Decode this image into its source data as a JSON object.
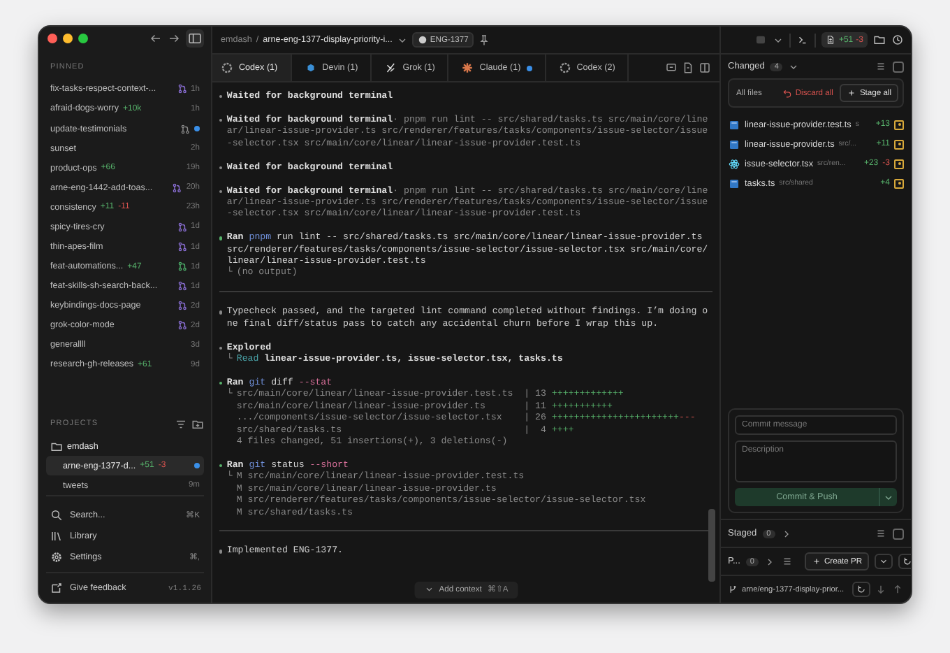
{
  "sidebar": {
    "pinned_label": "PINNED",
    "pinned": [
      {
        "name": "fix-tasks-respect-context-...",
        "pr": {
          "color": "#8b6fd6"
        },
        "time": "1h",
        "unread": false
      },
      {
        "name": "afraid-dogs-worry",
        "additions": "+10k",
        "time": "1h",
        "unread": false
      },
      {
        "name": "update-testimonials",
        "pr": {
          "color": "#8a8a8a"
        },
        "unread": true
      },
      {
        "name": "sunset",
        "time": "2h",
        "unread": false
      },
      {
        "name": "product-ops",
        "additions": "+66",
        "time": "19h",
        "unread": false
      },
      {
        "name": "arne-eng-1442-add-toas...",
        "pr": {
          "color": "#8b6fd6"
        },
        "time": "20h",
        "unread": false
      },
      {
        "name": "consistency",
        "additions": "+11",
        "deletions": "-11",
        "time": "23h",
        "unread": false
      },
      {
        "name": "spicy-tires-cry",
        "pr": {
          "color": "#8b6fd6"
        },
        "time": "1d",
        "unread": false
      },
      {
        "name": "thin-apes-film",
        "pr": {
          "color": "#8b6fd6"
        },
        "time": "1d",
        "unread": false
      },
      {
        "name": "feat-automations...",
        "additions": "+47",
        "pr": {
          "color": "#4caf6a"
        },
        "time": "1d",
        "unread": false
      },
      {
        "name": "feat-skills-sh-search-back...",
        "pr": {
          "color": "#8b6fd6"
        },
        "time": "1d",
        "unread": false
      },
      {
        "name": "keybindings-docs-page",
        "pr": {
          "color": "#8b6fd6"
        },
        "time": "2d",
        "unread": false
      },
      {
        "name": "grok-color-mode",
        "pr": {
          "color": "#8b6fd6"
        },
        "time": "2d",
        "unread": false
      },
      {
        "name": "generallll",
        "time": "3d",
        "unread": false
      },
      {
        "name": "research-gh-releases",
        "additions": "+61",
        "time": "9d",
        "unread": false
      }
    ],
    "projects_label": "PROJECTS",
    "projects": [
      {
        "name": "emdash",
        "children": [
          {
            "name": "arne-eng-1377-d...",
            "additions": "+51",
            "deletions": "-3",
            "unread": true,
            "selected": true
          },
          {
            "name": "tweets",
            "time": "9m",
            "unread": false,
            "selected": false
          }
        ]
      }
    ],
    "menu": [
      {
        "kind": "search",
        "label": "Search...",
        "shortcut": "⌘K"
      },
      {
        "kind": "library",
        "label": "Library"
      },
      {
        "kind": "settings",
        "label": "Settings",
        "shortcut": "⌘,"
      }
    ],
    "feedback": "Give feedback",
    "version": "v1.1.26"
  },
  "header": {
    "project": "emdash",
    "separator": "/",
    "branch": "arne-eng-1377-display-priority-i...",
    "issue": "ENG-1377"
  },
  "tabs": [
    {
      "label": "Codex (1)",
      "kind": "codex",
      "selected": true,
      "unread": false
    },
    {
      "label": "Devin (1)",
      "kind": "devin",
      "selected": false,
      "unread": false
    },
    {
      "label": "Grok (1)",
      "kind": "grok",
      "selected": false,
      "unread": false
    },
    {
      "label": "Claude (1)",
      "kind": "claude",
      "selected": false,
      "unread": true
    },
    {
      "label": "Codex (2)",
      "kind": "codex",
      "selected": false,
      "unread": false
    }
  ],
  "transcript": [
    {
      "kind": "event",
      "label": "Waited for background terminal"
    },
    {
      "kind": "event",
      "label": "Waited for background terminal",
      "detail": "· pnpm run lint -- src/shared/tasks.ts src/main/core/linear/linear-issue-provider.ts src/renderer/features/tasks/components/issue-selector/issue-selector.tsx src/main/core/linear/linear-issue-provider.test.ts"
    },
    {
      "kind": "event",
      "label": "Waited for background terminal"
    },
    {
      "kind": "event",
      "label": "Waited for background terminal",
      "detail": "· pnpm run lint -- src/shared/tasks.ts src/main/core/linear/linear-issue-provider.ts src/renderer/features/tasks/components/issue-selector/issue-selector.tsx src/main/core/linear/linear-issue-provider.test.ts"
    },
    {
      "kind": "ran",
      "label": "Ran",
      "segments": [
        {
          "text": "pnpm",
          "kind": "cmd"
        },
        {
          "text": " run lint -- src/shared/tasks.ts src/main/core/linear/linear-issue-provider.ts src/renderer/features/tasks/components/issue-selector/issue-selector.tsx src/main/core/linear/linear-issue-provider.test.ts",
          "kind": "plain"
        }
      ],
      "branch": "└",
      "output": [
        {
          "kind": "seg",
          "segments": [
            {
              "text": "(no output)",
              "kind": "muted"
            }
          ]
        }
      ]
    },
    {
      "kind": "divider"
    },
    {
      "kind": "message",
      "text": "Typecheck passed, and the targeted lint command completed without findings. I’m doing one final diff/status pass to catch any accidental churn before I wrap this up."
    },
    {
      "kind": "explored",
      "label": "Explored",
      "branch": "└",
      "output": [
        {
          "kind": "seg",
          "segments": [
            {
              "text": "Read",
              "kind": "link"
            },
            {
              "text": " linear-issue-provider.ts, issue-selector.tsx, tasks.ts",
              "kind": "bold"
            }
          ]
        }
      ]
    },
    {
      "kind": "ran",
      "label": "Ran",
      "segments": [
        {
          "text": "git",
          "kind": "cmd"
        },
        {
          "text": " diff ",
          "kind": "plain"
        },
        {
          "text": "--stat",
          "kind": "flag"
        }
      ],
      "branch": "└",
      "output": [
        {
          "kind": "stat",
          "path": "src/main/core/linear/linear-issue-provider.test.ts",
          "count": "| 13",
          "plus": "+++++++++++++"
        },
        {
          "kind": "stat",
          "path": "src/main/core/linear/linear-issue-provider.ts",
          "count": "| 11",
          "plus": "+++++++++++"
        },
        {
          "kind": "stat",
          "path": ".../components/issue-selector/issue-selector.tsx",
          "count": "| 26",
          "plus": "+++++++++++++++++++++++",
          "minus": "---"
        },
        {
          "kind": "stat",
          "path": "src/shared/tasks.ts",
          "count": "|  4",
          "plus": "++++"
        },
        {
          "kind": "seg",
          "segments": [
            {
              "text": "4 files changed, 51 insertions(+), 3 deletions(-)",
              "kind": "muted"
            }
          ]
        }
      ]
    },
    {
      "kind": "ran",
      "label": "Ran",
      "segments": [
        {
          "text": "git",
          "kind": "cmd"
        },
        {
          "text": " status ",
          "kind": "plain"
        },
        {
          "text": "--short",
          "kind": "flag"
        }
      ],
      "branch": "└",
      "output": [
        {
          "kind": "seg",
          "segments": [
            {
              "text": "M src/main/core/linear/linear-issue-provider.test.ts",
              "kind": "muted"
            }
          ]
        },
        {
          "kind": "seg",
          "segments": [
            {
              "text": "M src/main/core/linear/linear-issue-provider.ts",
              "kind": "muted"
            }
          ]
        },
        {
          "kind": "seg",
          "segments": [
            {
              "text": "M src/renderer/features/tasks/components/issue-selector/issue-selector.tsx",
              "kind": "muted"
            }
          ]
        },
        {
          "kind": "seg",
          "segments": [
            {
              "text": "M src/shared/tasks.ts",
              "kind": "muted"
            }
          ]
        }
      ]
    },
    {
      "kind": "divider"
    },
    {
      "kind": "message",
      "text": "Implemented ENG-1377."
    }
  ],
  "composer": {
    "label": "Add context",
    "shortcut": "⌘⇧A"
  },
  "toolbar": {
    "additions": "+51",
    "deletions": "-3"
  },
  "changes": {
    "title": "Changed",
    "count": "4",
    "checked": false,
    "filter": "All files",
    "discard": "Discard all",
    "stage": "Stage all",
    "files": [
      {
        "name": "linear-issue-provider.test.ts",
        "path": "s",
        "kind": "ts",
        "additions": "+13",
        "modified": true
      },
      {
        "name": "linear-issue-provider.ts",
        "path": "src/...",
        "kind": "ts",
        "additions": "+11",
        "modified": true
      },
      {
        "name": "issue-selector.tsx",
        "path": "src/ren...",
        "kind": "tsx",
        "additions": "+23",
        "deletions": "-3",
        "modified": true
      },
      {
        "name": "tasks.ts",
        "path": "src/shared",
        "kind": "ts",
        "additions": "+4",
        "modified": true
      }
    ]
  },
  "commit": {
    "message_placeholder": "Commit message",
    "description_placeholder": "Description",
    "button": "Commit & Push"
  },
  "staged": {
    "title": "Staged",
    "count": "0",
    "checked": false
  },
  "pr": {
    "title": "P...",
    "count": "0",
    "button": "Create PR"
  },
  "footer": {
    "branch": "arne/eng-1377-display-prior..."
  }
}
